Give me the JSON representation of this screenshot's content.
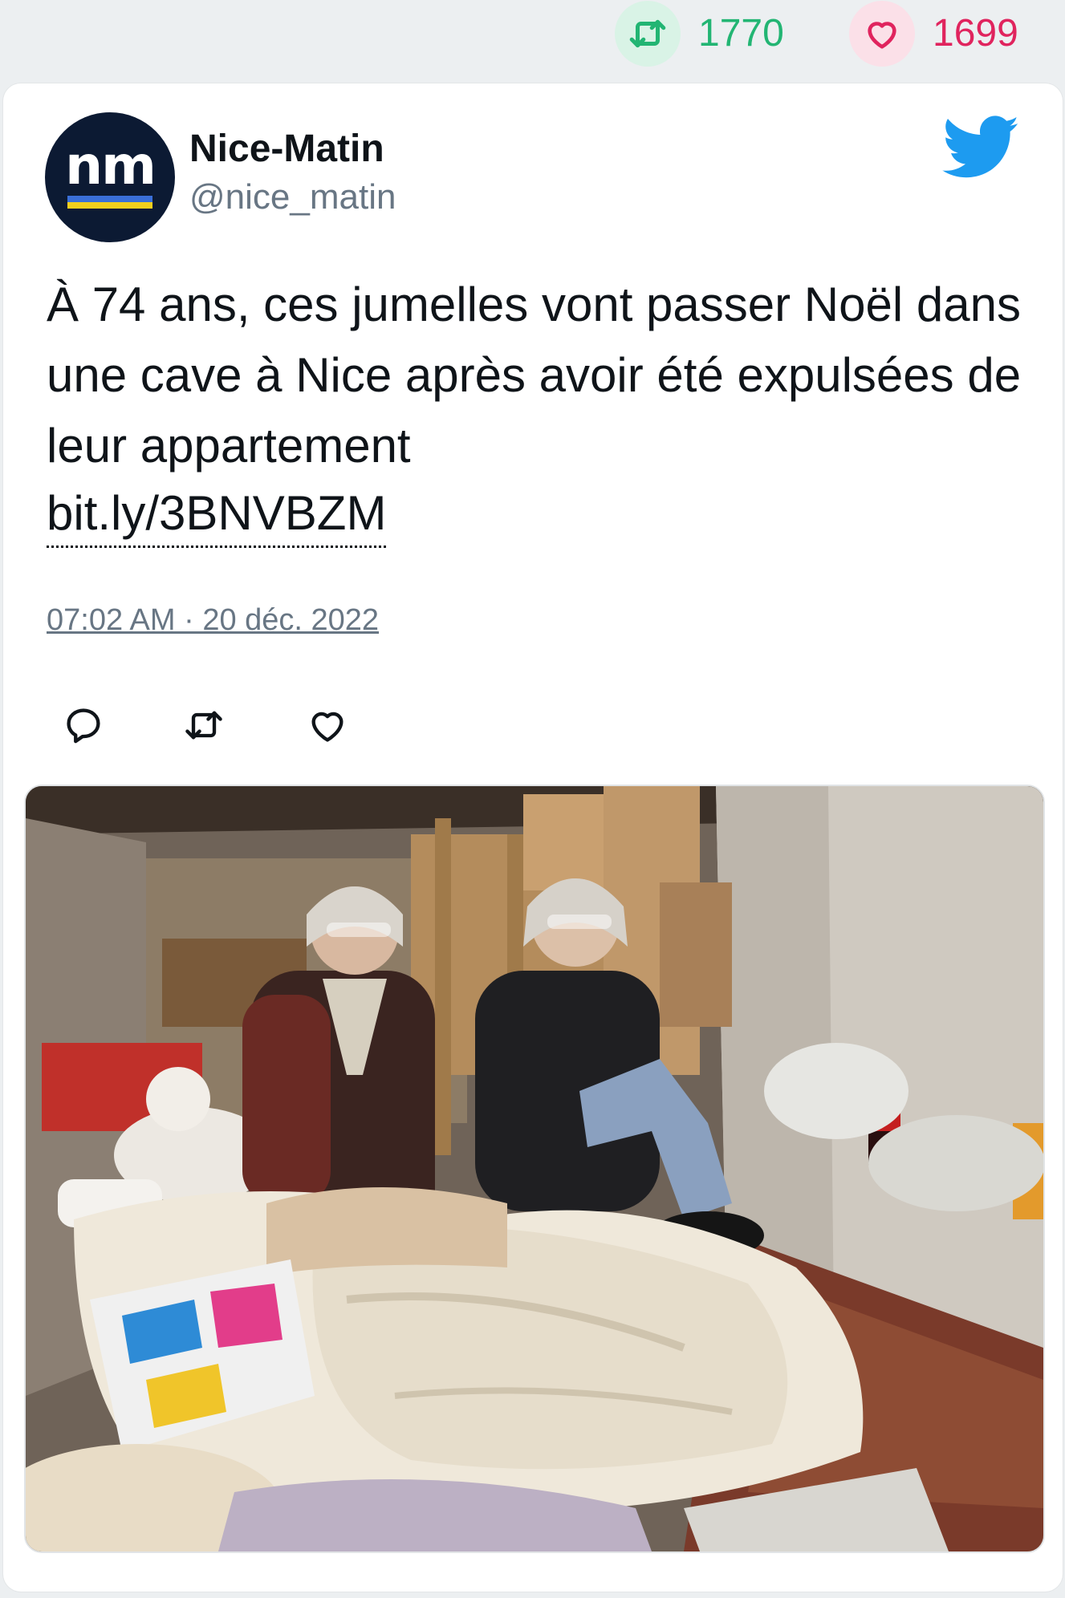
{
  "stats": {
    "retweets": "1770",
    "likes": "1699"
  },
  "account": {
    "avatar_text": "nm",
    "display_name": "Nice-Matin",
    "handle": "@nice_matin"
  },
  "tweet": {
    "text": "À 74 ans, ces jumelles vont passer Noël dans une cave à Nice après avoir été expulsées de leur appartement",
    "link": "bit.ly/3BNVBZM",
    "timestamp": "07:02 AM · 20 déc. 2022"
  },
  "icons": {
    "stats_retweet": "retweet-icon",
    "stats_like": "heart-icon",
    "brand": "twitter-bird-icon",
    "reply": "reply-icon",
    "retweet": "retweet-icon",
    "like": "heart-icon"
  },
  "colors": {
    "retweet_green": "#22b573",
    "like_red": "#e0245e",
    "twitter_blue": "#1d9bf0",
    "muted_text": "#687684",
    "avatar_bg": "#0c1a33"
  }
}
